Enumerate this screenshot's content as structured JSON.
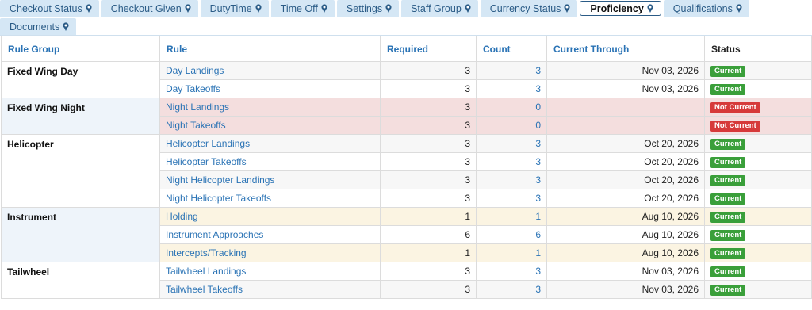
{
  "tabs_row1": [
    {
      "label": "Checkout Status",
      "active": false
    },
    {
      "label": "Checkout Given",
      "active": false
    },
    {
      "label": "DutyTime",
      "active": false
    },
    {
      "label": "Time Off",
      "active": false
    },
    {
      "label": "Settings",
      "active": false
    },
    {
      "label": "Staff Group",
      "active": false
    },
    {
      "label": "Currency Status",
      "active": false
    },
    {
      "label": "Proficiency",
      "active": true
    },
    {
      "label": "Qualifications",
      "active": false
    }
  ],
  "tabs_row2": [
    {
      "label": "Documents",
      "active": false
    }
  ],
  "table": {
    "headers": {
      "rule_group": "Rule Group",
      "rule": "Rule",
      "required": "Required",
      "count": "Count",
      "current_through": "Current Through",
      "status": "Status"
    },
    "groups": [
      {
        "name": "Fixed Wing Day",
        "rows": [
          {
            "rule": "Day Landings",
            "required": "3",
            "count": "3",
            "through": "Nov 03, 2026",
            "status": "Current",
            "state": "ok"
          },
          {
            "rule": "Day Takeoffs",
            "required": "3",
            "count": "3",
            "through": "Nov 03, 2026",
            "status": "Current",
            "state": "ok"
          }
        ]
      },
      {
        "name": "Fixed Wing Night",
        "rows": [
          {
            "rule": "Night Landings",
            "required": "3",
            "count": "0",
            "through": "",
            "status": "Not Current",
            "state": "bad"
          },
          {
            "rule": "Night Takeoffs",
            "required": "3",
            "count": "0",
            "through": "",
            "status": "Not Current",
            "state": "bad"
          }
        ]
      },
      {
        "name": "Helicopter",
        "rows": [
          {
            "rule": "Helicopter Landings",
            "required": "3",
            "count": "3",
            "through": "Oct 20, 2026",
            "status": "Current",
            "state": "ok"
          },
          {
            "rule": "Helicopter Takeoffs",
            "required": "3",
            "count": "3",
            "through": "Oct 20, 2026",
            "status": "Current",
            "state": "ok"
          },
          {
            "rule": "Night Helicopter Landings",
            "required": "3",
            "count": "3",
            "through": "Oct 20, 2026",
            "status": "Current",
            "state": "ok"
          },
          {
            "rule": "Night Helicopter Takeoffs",
            "required": "3",
            "count": "3",
            "through": "Oct 20, 2026",
            "status": "Current",
            "state": "ok"
          }
        ]
      },
      {
        "name": "Instrument",
        "rows": [
          {
            "rule": "Holding",
            "required": "1",
            "count": "1",
            "through": "Aug 10, 2026",
            "status": "Current",
            "state": "warn"
          },
          {
            "rule": "Instrument Approaches",
            "required": "6",
            "count": "6",
            "through": "Aug 10, 2026",
            "status": "Current",
            "state": "ok"
          },
          {
            "rule": "Intercepts/Tracking",
            "required": "1",
            "count": "1",
            "through": "Aug 10, 2026",
            "status": "Current",
            "state": "warn"
          }
        ]
      },
      {
        "name": "Tailwheel",
        "rows": [
          {
            "rule": "Tailwheel Landings",
            "required": "3",
            "count": "3",
            "through": "Nov 03, 2026",
            "status": "Current",
            "state": "ok"
          },
          {
            "rule": "Tailwheel Takeoffs",
            "required": "3",
            "count": "3",
            "through": "Nov 03, 2026",
            "status": "Current",
            "state": "ok"
          }
        ]
      }
    ]
  }
}
